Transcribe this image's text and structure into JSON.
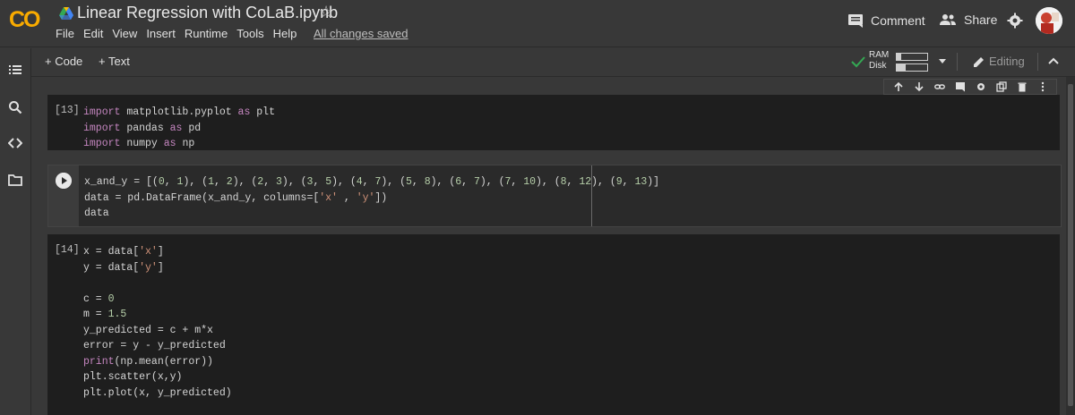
{
  "header": {
    "logo": "CO",
    "title": "Linear Regression with CoLaB.ipynb",
    "menu": [
      "File",
      "Edit",
      "View",
      "Insert",
      "Runtime",
      "Tools",
      "Help"
    ],
    "saved_status": "All changes saved",
    "comment_label": "Comment",
    "share_label": "Share"
  },
  "toolbar": {
    "add_code": "+ Code",
    "add_text": "+ Text",
    "ram_label": "RAM",
    "disk_label": "Disk",
    "ram_fraction": 0.15,
    "disk_fraction": 0.3,
    "editing_label": "Editing"
  },
  "cells": [
    {
      "exec_count": "[13]",
      "lines": [
        [
          {
            "t": "import",
            "c": "kw"
          },
          {
            "t": " matplotlib.pyplot ",
            "c": "grey"
          },
          {
            "t": "as",
            "c": "kw"
          },
          {
            "t": " plt",
            "c": "grey"
          }
        ],
        [
          {
            "t": "import",
            "c": "kw"
          },
          {
            "t": " pandas ",
            "c": "grey"
          },
          {
            "t": "as",
            "c": "kw"
          },
          {
            "t": " pd",
            "c": "grey"
          }
        ],
        [
          {
            "t": "import",
            "c": "kw"
          },
          {
            "t": " numpy ",
            "c": "grey"
          },
          {
            "t": "as",
            "c": "kw"
          },
          {
            "t": " np",
            "c": "grey"
          }
        ]
      ]
    },
    {
      "exec_count": "",
      "lines": [
        [
          {
            "t": "x_and_y = [(",
            "c": "grey"
          },
          {
            "t": "0",
            "c": "num"
          },
          {
            "t": ", ",
            "c": "grey"
          },
          {
            "t": "1",
            "c": "num"
          },
          {
            "t": "), (",
            "c": "grey"
          },
          {
            "t": "1",
            "c": "num"
          },
          {
            "t": ", ",
            "c": "grey"
          },
          {
            "t": "2",
            "c": "num"
          },
          {
            "t": "), (",
            "c": "grey"
          },
          {
            "t": "2",
            "c": "num"
          },
          {
            "t": ", ",
            "c": "grey"
          },
          {
            "t": "3",
            "c": "num"
          },
          {
            "t": "), (",
            "c": "grey"
          },
          {
            "t": "3",
            "c": "num"
          },
          {
            "t": ", ",
            "c": "grey"
          },
          {
            "t": "5",
            "c": "num"
          },
          {
            "t": "), (",
            "c": "grey"
          },
          {
            "t": "4",
            "c": "num"
          },
          {
            "t": ", ",
            "c": "grey"
          },
          {
            "t": "7",
            "c": "num"
          },
          {
            "t": "), (",
            "c": "grey"
          },
          {
            "t": "5",
            "c": "num"
          },
          {
            "t": ", ",
            "c": "grey"
          },
          {
            "t": "8",
            "c": "num"
          },
          {
            "t": "), (",
            "c": "grey"
          },
          {
            "t": "6",
            "c": "num"
          },
          {
            "t": ", ",
            "c": "grey"
          },
          {
            "t": "7",
            "c": "num"
          },
          {
            "t": "), (",
            "c": "grey"
          },
          {
            "t": "7",
            "c": "num"
          },
          {
            "t": ", ",
            "c": "grey"
          },
          {
            "t": "10",
            "c": "num"
          },
          {
            "t": "), (",
            "c": "grey"
          },
          {
            "t": "8",
            "c": "num"
          },
          {
            "t": ", ",
            "c": "grey"
          },
          {
            "t": "12",
            "c": "num"
          },
          {
            "t": "), (",
            "c": "grey"
          },
          {
            "t": "9",
            "c": "num"
          },
          {
            "t": ", ",
            "c": "grey"
          },
          {
            "t": "13",
            "c": "num"
          },
          {
            "t": ")]",
            "c": "grey"
          }
        ],
        [
          {
            "t": "data = pd.DataFrame(x_and_y, columns=[",
            "c": "grey"
          },
          {
            "t": "'x'",
            "c": "str"
          },
          {
            "t": " , ",
            "c": "grey"
          },
          {
            "t": "'y'",
            "c": "str"
          },
          {
            "t": "])",
            "c": "grey"
          }
        ],
        [
          {
            "t": "data",
            "c": "grey"
          }
        ]
      ]
    },
    {
      "exec_count": "[14]",
      "lines": [
        [
          {
            "t": "x = data[",
            "c": "grey"
          },
          {
            "t": "'x'",
            "c": "str"
          },
          {
            "t": "]",
            "c": "grey"
          }
        ],
        [
          {
            "t": "y = data[",
            "c": "grey"
          },
          {
            "t": "'y'",
            "c": "str"
          },
          {
            "t": "]",
            "c": "grey"
          }
        ],
        [
          {
            "t": "",
            "c": "grey"
          }
        ],
        [
          {
            "t": "c = ",
            "c": "grey"
          },
          {
            "t": "0",
            "c": "num"
          }
        ],
        [
          {
            "t": "m = ",
            "c": "grey"
          },
          {
            "t": "1.5",
            "c": "num"
          }
        ],
        [
          {
            "t": "y_predicted = c + m*x",
            "c": "grey"
          }
        ],
        [
          {
            "t": "error = y - y_predicted",
            "c": "grey"
          }
        ],
        [
          {
            "t": "print",
            "c": "fn"
          },
          {
            "t": "(np.mean(error))",
            "c": "grey"
          }
        ],
        [
          {
            "t": "plt.scatter(x,y)",
            "c": "grey"
          }
        ],
        [
          {
            "t": "plt.plot(x, y_predicted)",
            "c": "grey"
          }
        ]
      ]
    }
  ]
}
